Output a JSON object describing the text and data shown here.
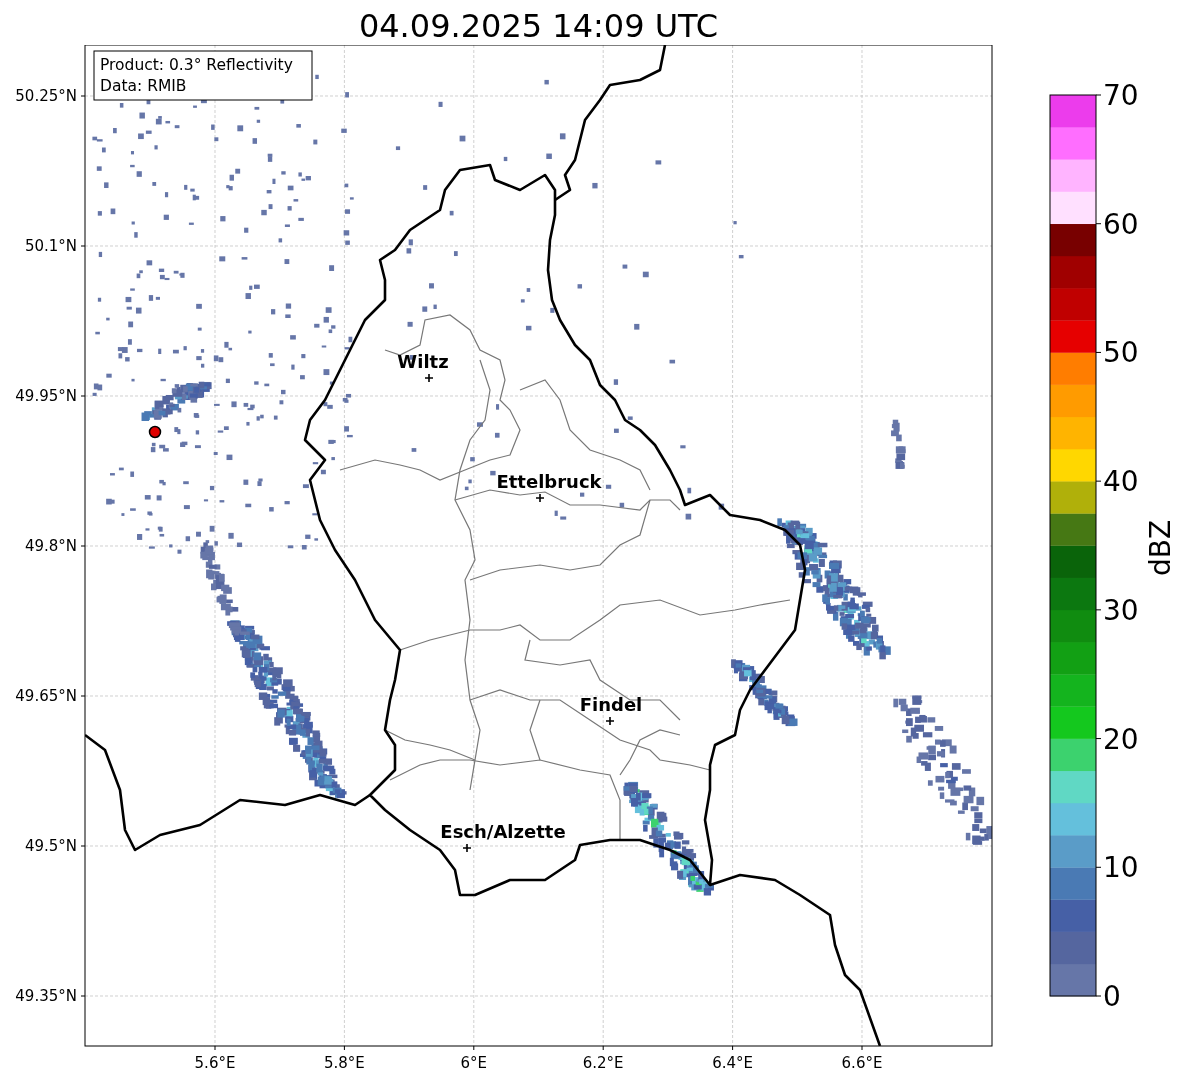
{
  "title": "04.09.2025 14:09 UTC",
  "info_box": {
    "product": "Product: 0.3° Reflectivity",
    "data": "Data: RMIB"
  },
  "map": {
    "yticks": [
      "50.25°N",
      "50.1°N",
      "49.95°N",
      "49.8°N",
      "49.65°N",
      "49.5°N",
      "49.35°N"
    ],
    "xticks": [
      "5.6°E",
      "5.8°E",
      "6°E",
      "6.2°E",
      "6.4°E",
      "6.6°E"
    ],
    "cities": [
      "Wiltz",
      "Ettelbruck",
      "Findel",
      "Esch/Alzette"
    ]
  },
  "colorbar": {
    "label": "dBZ",
    "ticks": [
      "70",
      "60",
      "50",
      "40",
      "30",
      "20",
      "10",
      "0"
    ],
    "bands": [
      {
        "color": "#6676a8"
      },
      {
        "color": "#55669f"
      },
      {
        "color": "#4660a6"
      },
      {
        "color": "#4a7ab4"
      },
      {
        "color": "#5a9cc8"
      },
      {
        "color": "#64c0dc"
      },
      {
        "color": "#60d8c4"
      },
      {
        "color": "#3cd26e"
      },
      {
        "color": "#14c81e"
      },
      {
        "color": "#14b41e"
      },
      {
        "color": "#12a014"
      },
      {
        "color": "#108c10"
      },
      {
        "color": "#0c7810"
      },
      {
        "color": "#0a640a"
      },
      {
        "color": "#467814"
      },
      {
        "color": "#b0b00a"
      },
      {
        "color": "#ffd700"
      },
      {
        "color": "#ffb400"
      },
      {
        "color": "#ff9b00"
      },
      {
        "color": "#ff7d00"
      },
      {
        "color": "#e60000"
      },
      {
        "color": "#c00000"
      },
      {
        "color": "#a00000"
      },
      {
        "color": "#780000"
      },
      {
        "color": "#ffe0ff"
      },
      {
        "color": "#ffb4ff"
      },
      {
        "color": "#ff6eff"
      },
      {
        "color": "#ec3cec"
      }
    ]
  }
}
